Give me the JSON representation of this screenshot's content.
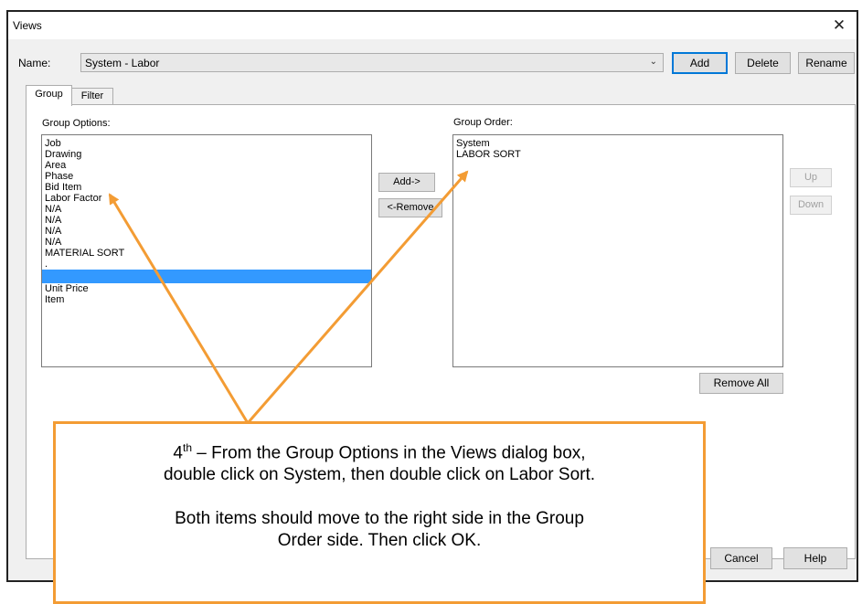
{
  "window": {
    "title": "Views"
  },
  "name_row": {
    "label": "Name:",
    "value": "System - Labor",
    "add": "Add",
    "delete": "Delete",
    "rename": "Rename"
  },
  "tabs": [
    {
      "label": "Group"
    },
    {
      "label": "Filter"
    }
  ],
  "group_options": {
    "label": "Group Options:",
    "items": [
      "Job",
      "Drawing",
      "Area",
      "Phase",
      "Bid Item",
      "Labor Factor",
      "N/A",
      "N/A",
      "N/A",
      "N/A",
      "MATERIAL SORT",
      ".",
      "",
      "Unit Price",
      "Item"
    ],
    "selected_index": 12
  },
  "move_buttons": {
    "add": "Add->",
    "remove": "<-Remove"
  },
  "group_order": {
    "label": "Group Order:",
    "items": [
      "System",
      "LABOR SORT"
    ]
  },
  "order_buttons": {
    "up": "Up",
    "down": "Down",
    "remove_all": "Remove All"
  },
  "footer": {
    "cancel": "Cancel",
    "help": "Help"
  },
  "callout": {
    "ordinal": "4",
    "ordinal_suffix": "th",
    "line1": " – From the Group Options in the Views dialog box,",
    "line2": "double click on System, then double click on Labor Sort.",
    "line3": "Both items should move to the right side in the Group",
    "line4": "Order side.  Then click OK."
  },
  "colors": {
    "arrow": "#f39c34",
    "selection": "#3399ff",
    "primary_border": "#0078d7"
  },
  "icons": {
    "close": "close-icon",
    "dropdown": "chevron-down-icon"
  }
}
